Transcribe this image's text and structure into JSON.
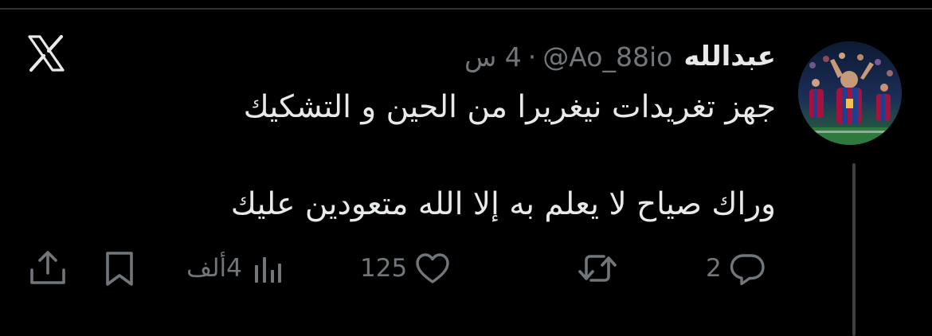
{
  "tweet": {
    "author_name": "عبدالله",
    "handle": "@Ao_88io",
    "separator": "·",
    "time_ago": "4 س",
    "lines": [
      "جهز تغريدات نيغريرا من الحين و التشكيك",
      "وراك صياح لا يعلم به إلا الله متعودين عليك"
    ]
  },
  "actions": {
    "replies": "2",
    "likes": "125",
    "views": "4ألف"
  },
  "icons": {
    "logo": "x-logo-icon",
    "reply": "reply-icon",
    "retweet": "retweet-icon",
    "like": "heart-icon",
    "views": "views-bar-chart-icon",
    "bookmark": "bookmark-icon",
    "share": "share-icon"
  },
  "colors": {
    "background": "#000000",
    "text_primary": "#e7e9ea",
    "text_secondary": "#71767b",
    "divider": "#2f3336"
  }
}
